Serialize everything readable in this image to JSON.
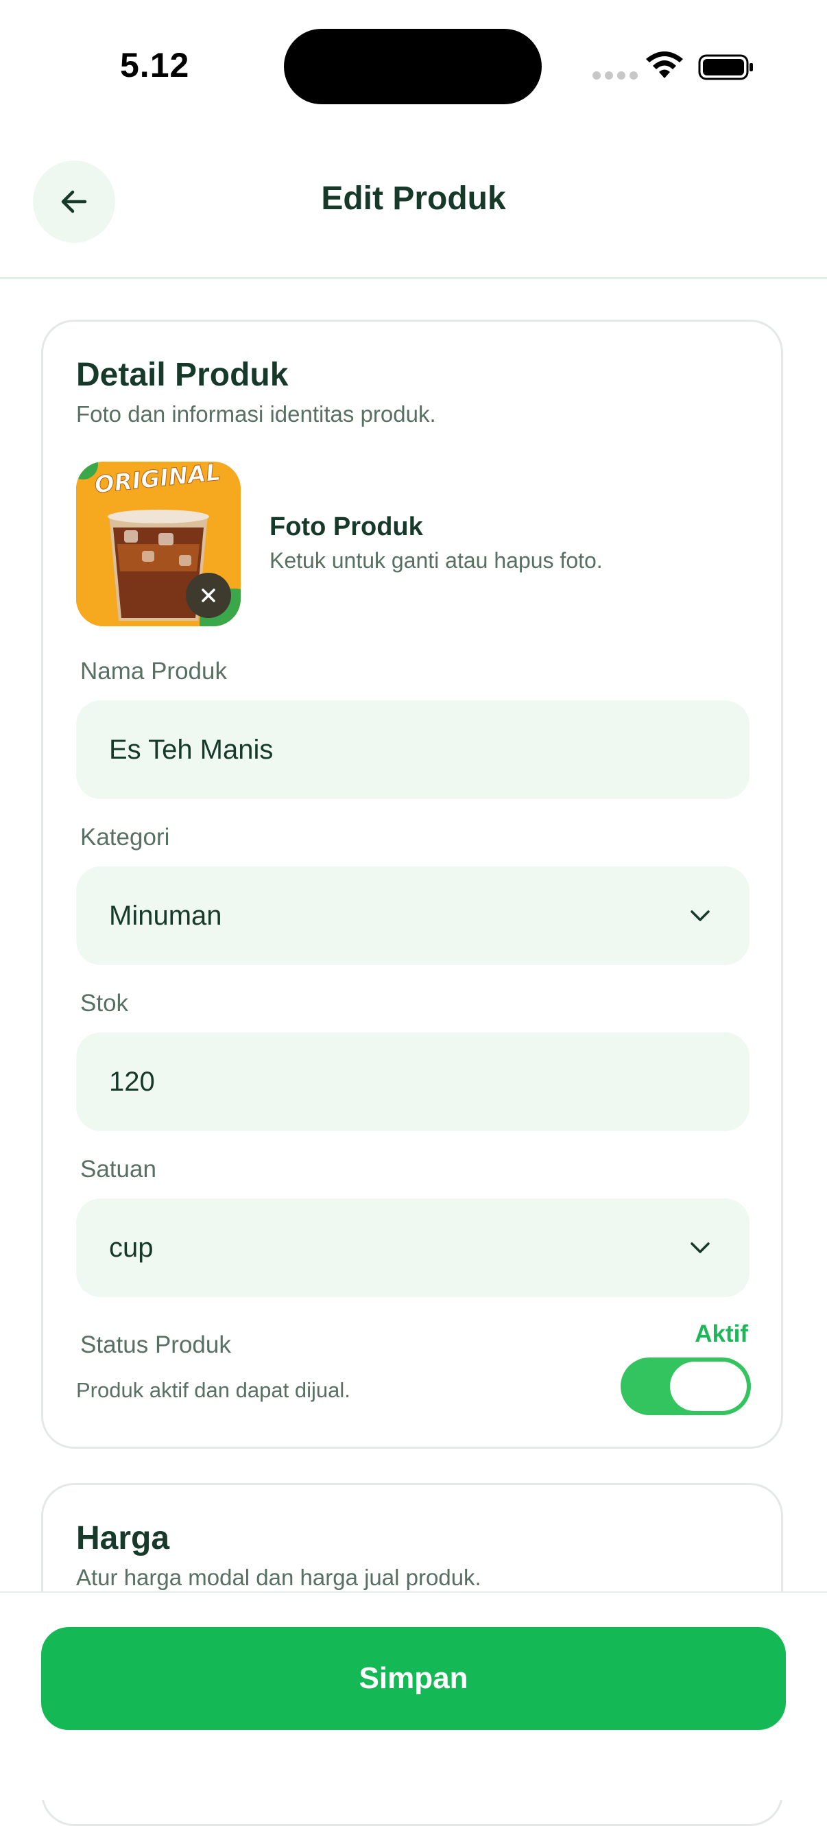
{
  "status_bar": {
    "time": "5.12"
  },
  "header": {
    "title": "Edit Produk",
    "back_icon": "arrow-left-icon"
  },
  "detail_card": {
    "title": "Detail Produk",
    "subtitle": "Foto dan informasi identitas produk.",
    "photo": {
      "title": "Foto Produk",
      "hint": "Ketuk untuk ganti atau hapus foto.",
      "image_text": "ORIGINAL",
      "remove_icon": "close-icon"
    },
    "fields": {
      "name": {
        "label": "Nama Produk",
        "value": "Es Teh Manis"
      },
      "category": {
        "label": "Kategori",
        "value": "Minuman",
        "icon": "chevron-down-icon"
      },
      "stock": {
        "label": "Stok",
        "value": "120"
      },
      "unit": {
        "label": "Satuan",
        "value": "cup",
        "icon": "chevron-down-icon"
      }
    },
    "status": {
      "label": "Status Produk",
      "description": "Produk aktif dan dapat dijual.",
      "value": "Aktif",
      "enabled": true
    }
  },
  "harga_card": {
    "title": "Harga",
    "subtitle": "Atur harga modal dan harga jual produk."
  },
  "footer": {
    "save_label": "Simpan"
  },
  "colors": {
    "primary": "#14b855",
    "toggle_on": "#34c45f",
    "field_bg": "#eff9f2",
    "title_text": "#16392a",
    "muted_text": "#587062"
  }
}
